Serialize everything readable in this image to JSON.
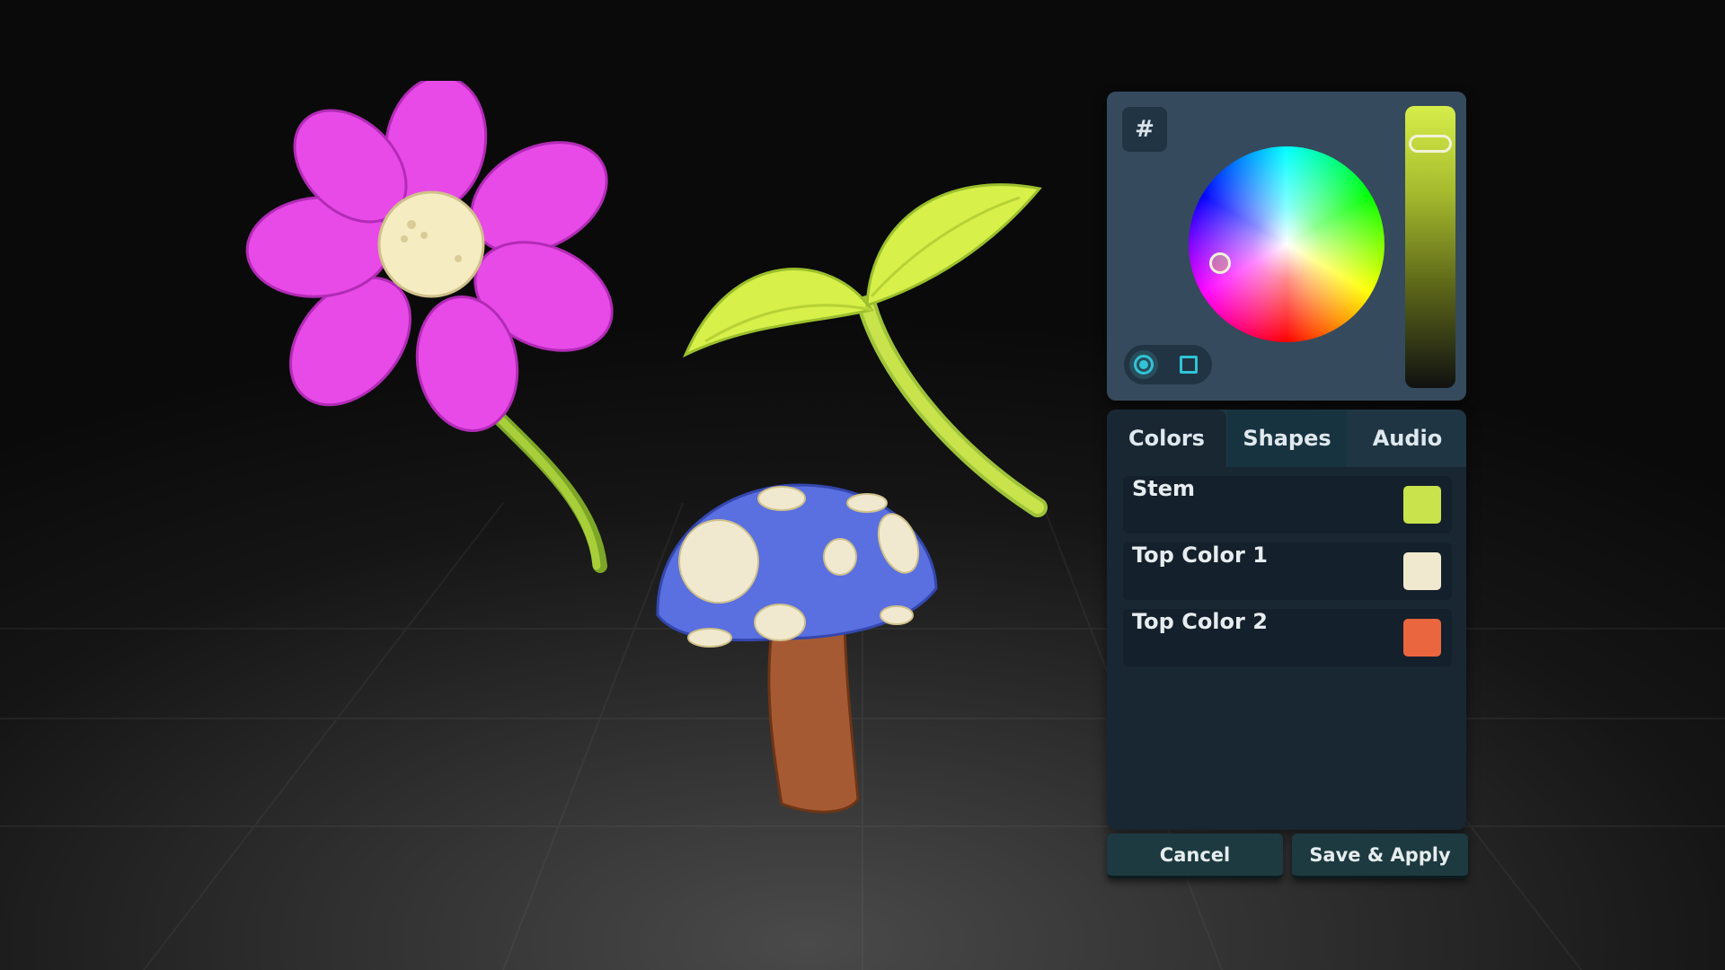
{
  "picker": {
    "hex_label": "#",
    "icons": {
      "wheel_mode": "circle-mode-icon",
      "square_mode": "square-mode-icon"
    },
    "selected_color": "#c8e34b"
  },
  "tabs": [
    {
      "label": "Colors"
    },
    {
      "label": "Shapes"
    },
    {
      "label": "Audio"
    }
  ],
  "colors": [
    {
      "label": "Stem",
      "swatch": "#c8e34b"
    },
    {
      "label": "Top Color 1",
      "swatch": "#f1e9cf"
    },
    {
      "label": "Top Color 2",
      "swatch": "#e9663f"
    }
  ],
  "buttons": {
    "cancel": "Cancel",
    "save": "Save & Apply"
  },
  "scene": {
    "flower_petal_color": "#e84ae8",
    "flower_center_color": "#f5ecc2",
    "sprout_color": "#d8f04a",
    "mushroom_cap_color": "#5a6fe0",
    "mushroom_stem_color": "#a65a33"
  }
}
